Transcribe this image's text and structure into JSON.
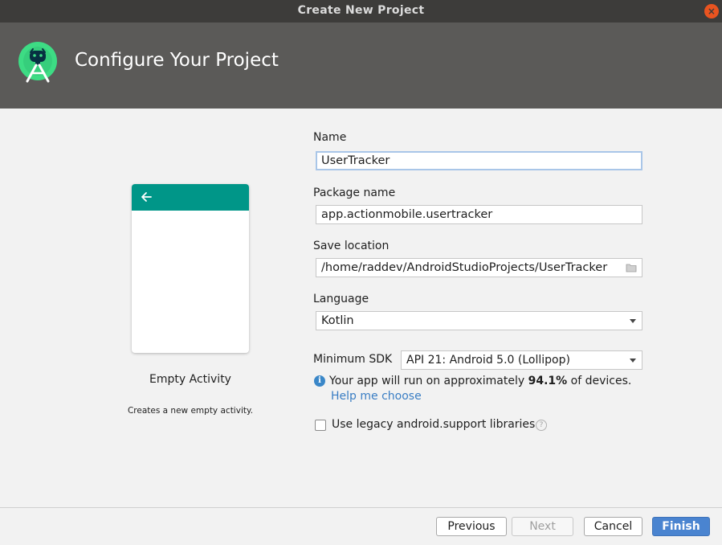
{
  "window": {
    "title": "Create New Project",
    "close_glyph": "×"
  },
  "header": {
    "title": "Configure Your Project",
    "logo_icon": "android-studio-icon"
  },
  "template": {
    "name": "Empty Activity",
    "description": "Creates a new empty activity.",
    "toolbar_color": "#009688"
  },
  "form": {
    "name_label": "Name",
    "name_value": "UserTracker",
    "package_label": "Package name",
    "package_value": "app.actionmobile.usertracker",
    "save_label": "Save location",
    "save_value": "/home/raddev/AndroidStudioProjects/UserTracker",
    "language_label": "Language",
    "language_value": "Kotlin",
    "sdk_label": "Minimum SDK",
    "sdk_value": "API 21: Android 5.0 (Lollipop)",
    "info_prefix": "Your app will run on approximately ",
    "info_percent": "94.1%",
    "info_suffix": " of devices.",
    "help_link": "Help me choose",
    "legacy_label": "Use legacy android.support libraries",
    "legacy_checked": false
  },
  "buttons": {
    "previous": "Previous",
    "next": "Next",
    "cancel": "Cancel",
    "finish": "Finish"
  },
  "colors": {
    "accent": "#4a84d0",
    "link": "#3a7ec4",
    "header_bg": "#5b5a58",
    "titlebar_bg": "#3d3c3a",
    "close_button": "#e95420"
  }
}
